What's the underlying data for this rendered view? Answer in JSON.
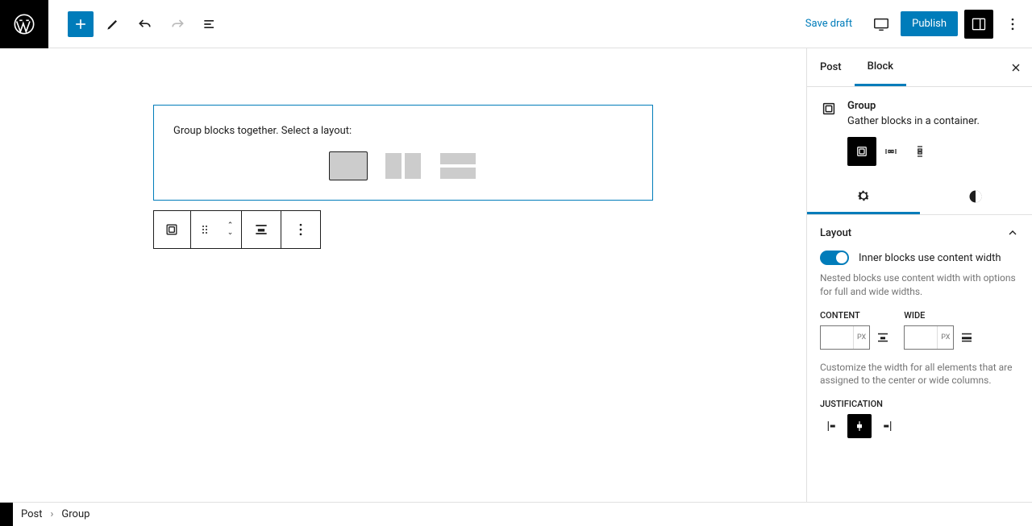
{
  "topbar": {
    "save_draft": "Save draft",
    "publish": "Publish"
  },
  "canvas": {
    "group_prompt": "Group blocks together. Select a layout:"
  },
  "sidebar": {
    "tab_post": "Post",
    "tab_block": "Block",
    "block_name": "Group",
    "block_desc": "Gather blocks in a container.",
    "layout": {
      "heading": "Layout",
      "toggle_label": "Inner blocks use content width",
      "toggle_help": "Nested blocks use content width with options for full and wide widths.",
      "content_label": "CONTENT",
      "wide_label": "WIDE",
      "unit": "PX",
      "width_help": "Customize the width for all elements that are assigned to the center or wide columns.",
      "justification_label": "JUSTIFICATION"
    }
  },
  "footer": {
    "crumb1": "Post",
    "crumb2": "Group"
  }
}
